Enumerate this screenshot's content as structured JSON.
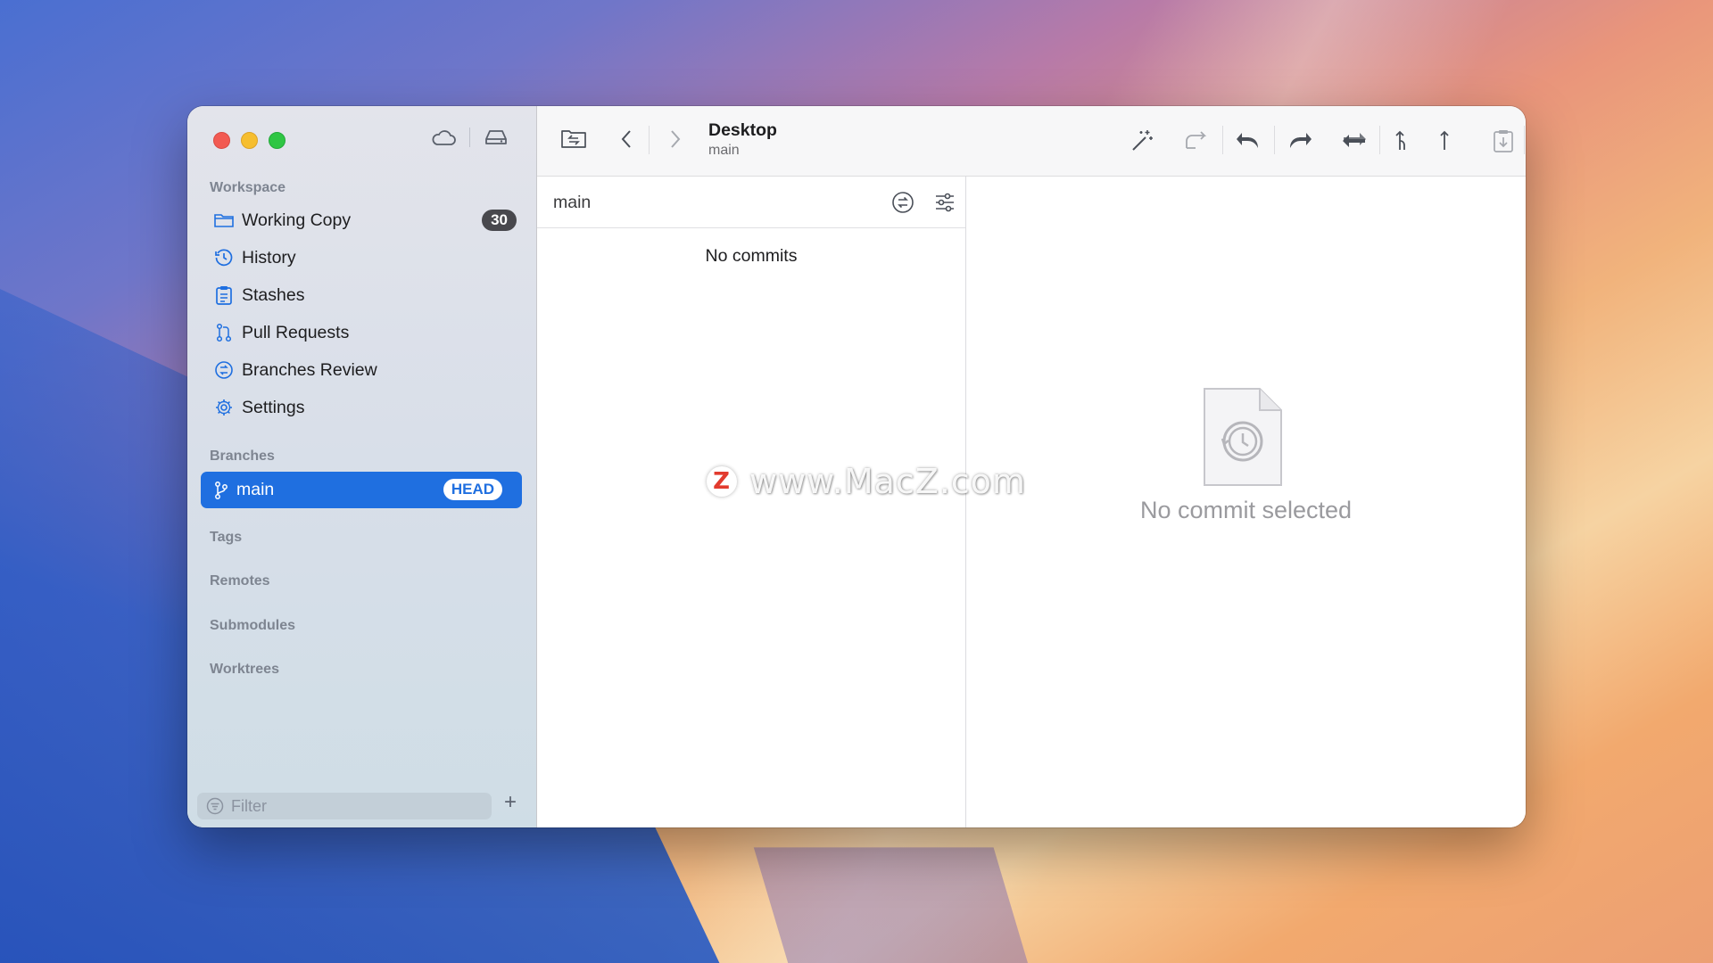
{
  "window": {
    "title": "Desktop",
    "subtitle": "main"
  },
  "sidebar": {
    "workspace_label": "Workspace",
    "workspace_items": [
      {
        "label": "Working Copy",
        "icon": "folder-icon",
        "badge": "30"
      },
      {
        "label": "History",
        "icon": "clock-icon"
      },
      {
        "label": "Stashes",
        "icon": "clipboard-icon"
      },
      {
        "label": "Pull Requests",
        "icon": "pull-request-icon"
      },
      {
        "label": "Branches Review",
        "icon": "branches-review-icon"
      },
      {
        "label": "Settings",
        "icon": "gear-icon"
      }
    ],
    "branches_label": "Branches",
    "branches": [
      {
        "label": "main",
        "badge": "HEAD",
        "selected": true
      }
    ],
    "tags_label": "Tags",
    "remotes_label": "Remotes",
    "submodules_label": "Submodules",
    "worktrees_label": "Worktrees",
    "filter_placeholder": "Filter"
  },
  "commit_list": {
    "branch": "main",
    "empty_text": "No commits"
  },
  "detail": {
    "empty_text": "No commit selected"
  },
  "watermark": {
    "logo_letter": "Z",
    "text": "www.MacZ.com"
  },
  "colors": {
    "accent": "#1f6fe0",
    "badge_dark": "#48484d"
  }
}
